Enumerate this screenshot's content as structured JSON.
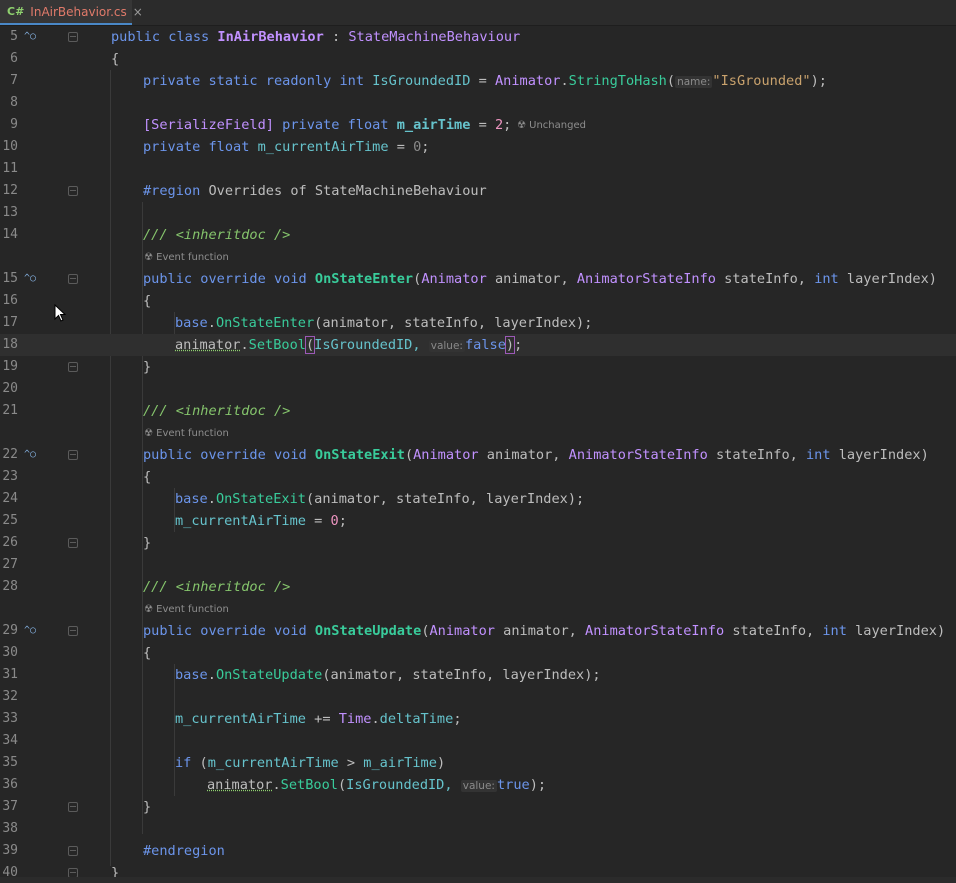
{
  "tab": {
    "lang": "C#",
    "filename": "InAirBehavior.cs",
    "close": "×"
  },
  "hints": {
    "unchanged": "☢ Unchanged",
    "event_function": "☢ Event function",
    "param_name": "name:",
    "param_value": "value:"
  },
  "lines": [
    {
      "n": "5"
    },
    {
      "n": "6"
    },
    {
      "n": "7"
    },
    {
      "n": "8"
    },
    {
      "n": "9"
    },
    {
      "n": "10"
    },
    {
      "n": "11"
    },
    {
      "n": "12"
    },
    {
      "n": "13"
    },
    {
      "n": "14"
    },
    {
      "n": "15"
    },
    {
      "n": "16"
    },
    {
      "n": "17"
    },
    {
      "n": "18"
    },
    {
      "n": "19"
    },
    {
      "n": "20"
    },
    {
      "n": "21"
    },
    {
      "n": "22"
    },
    {
      "n": "23"
    },
    {
      "n": "24"
    },
    {
      "n": "25"
    },
    {
      "n": "26"
    },
    {
      "n": "27"
    },
    {
      "n": "28"
    },
    {
      "n": "29"
    },
    {
      "n": "30"
    },
    {
      "n": "31"
    },
    {
      "n": "32"
    },
    {
      "n": "33"
    },
    {
      "n": "34"
    },
    {
      "n": "35"
    },
    {
      "n": "36"
    },
    {
      "n": "37"
    },
    {
      "n": "38"
    },
    {
      "n": "39"
    },
    {
      "n": "40"
    }
  ],
  "tok": {
    "public": "public",
    "class": "class",
    "classname": "InAirBehavior",
    "colon": " : ",
    "base_type": "StateMachineBehaviour",
    "lbrace": "{",
    "rbrace": "}",
    "private": "private",
    "static": "static",
    "readonly": "readonly",
    "int": "int",
    "id_field": "IsGroundedID",
    "eq": " = ",
    "animator_type": "Animator",
    "dot": ".",
    "stringtohash": "StringToHash",
    "lparen": "(",
    "str_isgrounded": "\"IsGrounded\"",
    "rparen_semi": ");",
    "serialize": "[SerializeField]",
    "float": "float",
    "airtime": "m_airTime",
    "two": "2",
    "semi": ";",
    "curairtime": "m_currentAirTime",
    "zero": "0",
    "region": "#region",
    "region_name": " Overrides of StateMachineBehaviour",
    "doc_slashes": "///",
    "doc_tag": "<inheritdoc />",
    "override": "override",
    "void": "void",
    "onstateenter": "OnStateEnter",
    "onstateexit": "OnStateExit",
    "onstateupdate": "OnStateUpdate",
    "param_animator": " animator, ",
    "stateinfo_type": "AnimatorStateInfo",
    "param_stateinfo": " stateInfo, ",
    "param_layer": " layerIndex)",
    "base": "base",
    "call_args": "(animator, stateInfo, layerIndex);",
    "animator_var": "animator",
    "setbool": "SetBool",
    "id_arg": "IsGroundedID, ",
    "false": "false",
    "true": "true",
    "rparen": ")",
    "plus_eq": " += ",
    "time": "Time",
    "deltatime": "deltaTime",
    "if": "if",
    "cond_open": " (",
    "gt": " > ",
    "endregion": "#endregion"
  }
}
